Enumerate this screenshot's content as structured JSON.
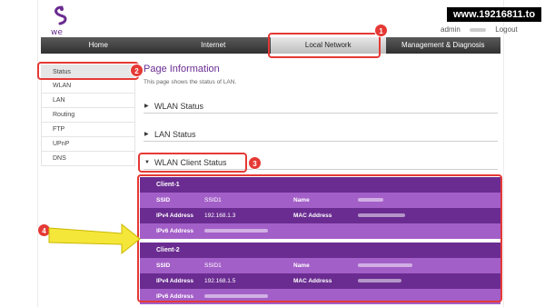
{
  "watermark": "www.19216811.to",
  "brand": {
    "logo_text": "we"
  },
  "header": {
    "admin": "admin",
    "help": "Help",
    "logout": "Logout"
  },
  "nav": [
    {
      "label": "Home"
    },
    {
      "label": "Internet"
    },
    {
      "label": "Local Network"
    },
    {
      "label": "Management & Diagnosis"
    }
  ],
  "sidebar": [
    {
      "label": "Status"
    },
    {
      "label": "WLAN"
    },
    {
      "label": "LAN"
    },
    {
      "label": "Routing"
    },
    {
      "label": "FTP"
    },
    {
      "label": "UPnP"
    },
    {
      "label": "DNS"
    }
  ],
  "main": {
    "title": "Page Information",
    "description": "This page shows the status of LAN.",
    "sections": [
      {
        "label": "WLAN Status",
        "expanded": false
      },
      {
        "label": "LAN Status",
        "expanded": false
      },
      {
        "label": "WLAN Client Status",
        "expanded": true
      }
    ]
  },
  "clients": [
    {
      "title": "Client-1",
      "ssid_label": "SSID",
      "ssid": "SSID1",
      "name_label": "Name",
      "ipv4_label": "IPv4 Address",
      "ipv4": "192.168.1.3",
      "mac_label": "MAC Address",
      "ipv6_label": "IPv6 Address"
    },
    {
      "title": "Client-2",
      "ssid_label": "SSID",
      "ssid": "SSID1",
      "name_label": "Name",
      "ipv4_label": "IPv4 Address",
      "ipv4": "192.168.1.5",
      "mac_label": "MAC Address",
      "ipv6_label": "IPv6 Address"
    }
  ],
  "annotations": [
    "1",
    "2",
    "3",
    "4"
  ],
  "colors": {
    "brand_purple": "#6a2c91",
    "row_light": "#a35fc8",
    "annotation_red": "#e53935",
    "arrow_yellow": "#f5e63a"
  }
}
